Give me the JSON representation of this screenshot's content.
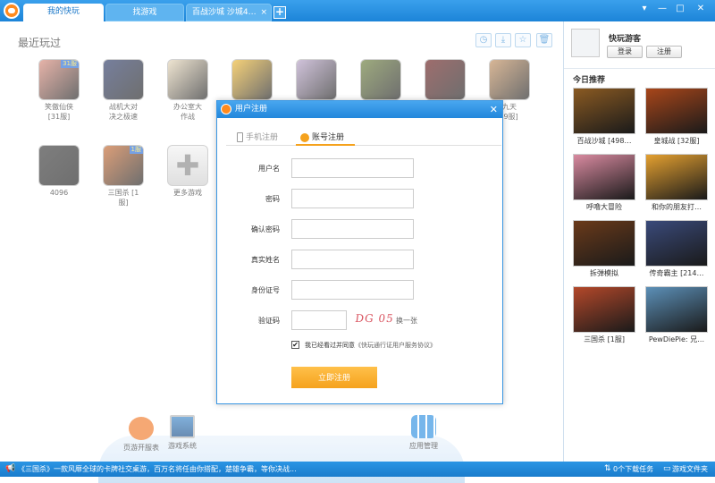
{
  "titlebar": {
    "tabs": [
      {
        "label": "我的快玩"
      },
      {
        "label": "找游戏"
      },
      {
        "label": "百战沙城 沙城4…"
      }
    ],
    "close_tab_glyph": "×",
    "new_tab_glyph": "+",
    "window_buttons": [
      "▾",
      "—",
      "□",
      "✕"
    ]
  },
  "main": {
    "recent_title": "最近玩过",
    "toolbar_icons": [
      "clock-icon",
      "download-icon",
      "star-icon",
      "trash-icon"
    ],
    "games": [
      {
        "name": "笑傲仙侠\n[31服]",
        "badge": "31服",
        "color": "#d98a7a"
      },
      {
        "name": "战机大对\n决之极速",
        "badge": "",
        "color": "#2d3b68"
      },
      {
        "name": "办公室大\n作战",
        "badge": "",
        "color": "#e6d6b8"
      },
      {
        "name": "",
        "badge": "",
        "color": "#f0b830"
      },
      {
        "name": "",
        "badge": "",
        "color": "#b7a2c7"
      },
      {
        "name": "",
        "badge": "",
        "color": "#6a7d3a"
      },
      {
        "name": "",
        "badge": "",
        "color": "#6a2020"
      },
      {
        "name": "九天\n[9服]",
        "badge": "",
        "color": "#c28f5e"
      },
      {
        "name": "4096",
        "badge": "",
        "color": "#3a3a3a"
      },
      {
        "name": "三国杀 [1\n服]",
        "badge": "1服",
        "color": "#c86a30"
      },
      {
        "name": "更多游戏",
        "badge": "",
        "color": "#dcdcdc"
      }
    ],
    "more_glyph": "✚"
  },
  "dock": {
    "items": [
      {
        "label": "页游开服表",
        "color": "#f07a2a"
      },
      {
        "label": "游戏系统",
        "color": "#2a6fb8"
      },
      {
        "label": "应用管理",
        "color": "#2d8fe0"
      }
    ]
  },
  "statusbar": {
    "ticker": "《三国杀》一款风靡全球的卡牌社交桌游，百万名将任由你搭配，楚雄争霸，等你决战...",
    "tasks": "0个下载任务",
    "folder": "游戏文件夹"
  },
  "sidebar": {
    "username": "快玩游客",
    "login": "登录",
    "register": "注册",
    "today_title": "今日推荐",
    "recommendations": [
      {
        "name": "百战沙城 [498…",
        "color": "#8a5a22"
      },
      {
        "name": "皇城战 [32服]",
        "color": "#a8461a"
      },
      {
        "name": "呼噜大冒险",
        "color": "#d98aa0"
      },
      {
        "name": "和你的朋友打…",
        "color": "#e4a030"
      },
      {
        "name": "拆弹模拟",
        "color": "#6a3a1a"
      },
      {
        "name": "传奇霸主 [214…",
        "color": "#3a4a7a"
      },
      {
        "name": "三国杀 [1服]",
        "color": "#b4482a"
      },
      {
        "name": "PewDiePie: 兄…",
        "color": "#5c90b8"
      }
    ]
  },
  "dialog": {
    "title": "用户注册",
    "close": "✕",
    "tab_phone": "手机注册",
    "tab_account": "账号注册",
    "fields": [
      {
        "label": "用户名",
        "value": ""
      },
      {
        "label": "密码",
        "value": ""
      },
      {
        "label": "确认密码",
        "value": ""
      },
      {
        "label": "真实姓名",
        "value": ""
      },
      {
        "label": "身份证号",
        "value": ""
      },
      {
        "label": "验证码",
        "value": ""
      }
    ],
    "captcha_text": "DG 05",
    "refresh_captcha": "换一张",
    "agree_text": "我已经看过并同意",
    "agreement_link": "《快玩通行证用户服务协议》",
    "submit": "立即注册",
    "accent_color": "#f5a21d"
  }
}
